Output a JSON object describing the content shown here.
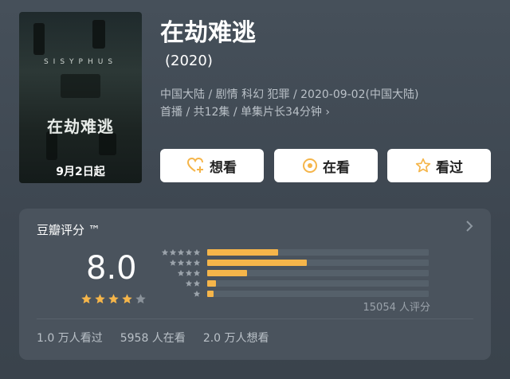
{
  "poster": {
    "en_title": "SISYPHUS",
    "cn_title": "在劫难逃",
    "release_note": "9月2日起"
  },
  "title": "在劫难逃",
  "year": "(2020)",
  "meta": {
    "line1": "中国大陆 / 剧情 科幻 犯罪 / 2020-09-02(中国大陆)",
    "line2": "首播 / 共12集 / 单集片长34分钟 ›"
  },
  "actions": {
    "want": "想看",
    "watching": "在看",
    "watched": "看过"
  },
  "rating": {
    "title": "豆瓣评分 ™",
    "score": "8.0",
    "stars_filled": 4,
    "stars_total": 5,
    "distribution": [
      {
        "stars": 5,
        "fraction": 0.32
      },
      {
        "stars": 4,
        "fraction": 0.45
      },
      {
        "stars": 3,
        "fraction": 0.18
      },
      {
        "stars": 2,
        "fraction": 0.04
      },
      {
        "stars": 1,
        "fraction": 0.03
      }
    ],
    "raters": "15054 人评分"
  },
  "stats": {
    "watched": "1.0 万人看过",
    "watching": "5958 人在看",
    "want": "2.0 万人想看"
  },
  "colors": {
    "accent_star": "#f5b54a",
    "background": "#434c56"
  }
}
